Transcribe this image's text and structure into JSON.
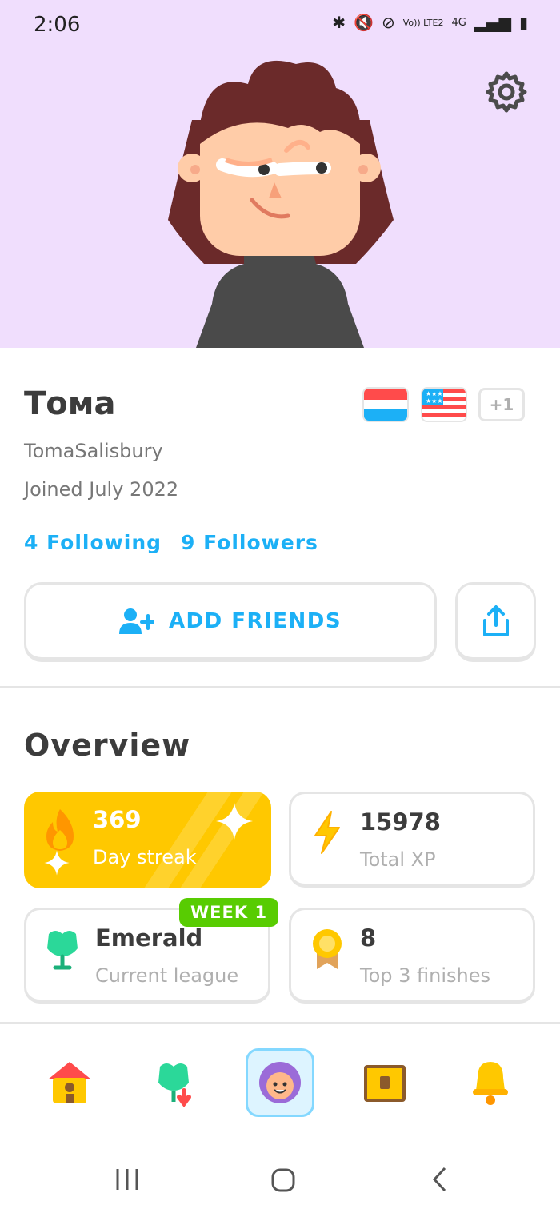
{
  "status_bar": {
    "time": "2:06",
    "network": "4G",
    "carrier": "Vo)) LTE2"
  },
  "profile": {
    "display_name": "Тома",
    "username": "TomaSalisbury",
    "joined": "Joined July 2022",
    "following": "4 Following",
    "followers": "9 Followers",
    "extra_languages": "+1"
  },
  "actions": {
    "add_friends_label": "ADD FRIENDS"
  },
  "overview": {
    "title": "Overview",
    "cards": [
      {
        "value": "369",
        "label": "Day streak"
      },
      {
        "value": "15978",
        "label": "Total XP"
      },
      {
        "value": "Emerald",
        "label": "Current league",
        "badge": "WEEK 1"
      },
      {
        "value": "8",
        "label": "Top 3 finishes"
      }
    ]
  },
  "colors": {
    "accent_blue": "#1cb0f6",
    "streak_yellow": "#ffc800",
    "badge_green": "#58cc02",
    "hero_bg": "#f0defd"
  },
  "nav": {
    "items": [
      "home-icon",
      "leagues-icon",
      "profile-icon",
      "shop-icon",
      "notifications-icon"
    ]
  }
}
